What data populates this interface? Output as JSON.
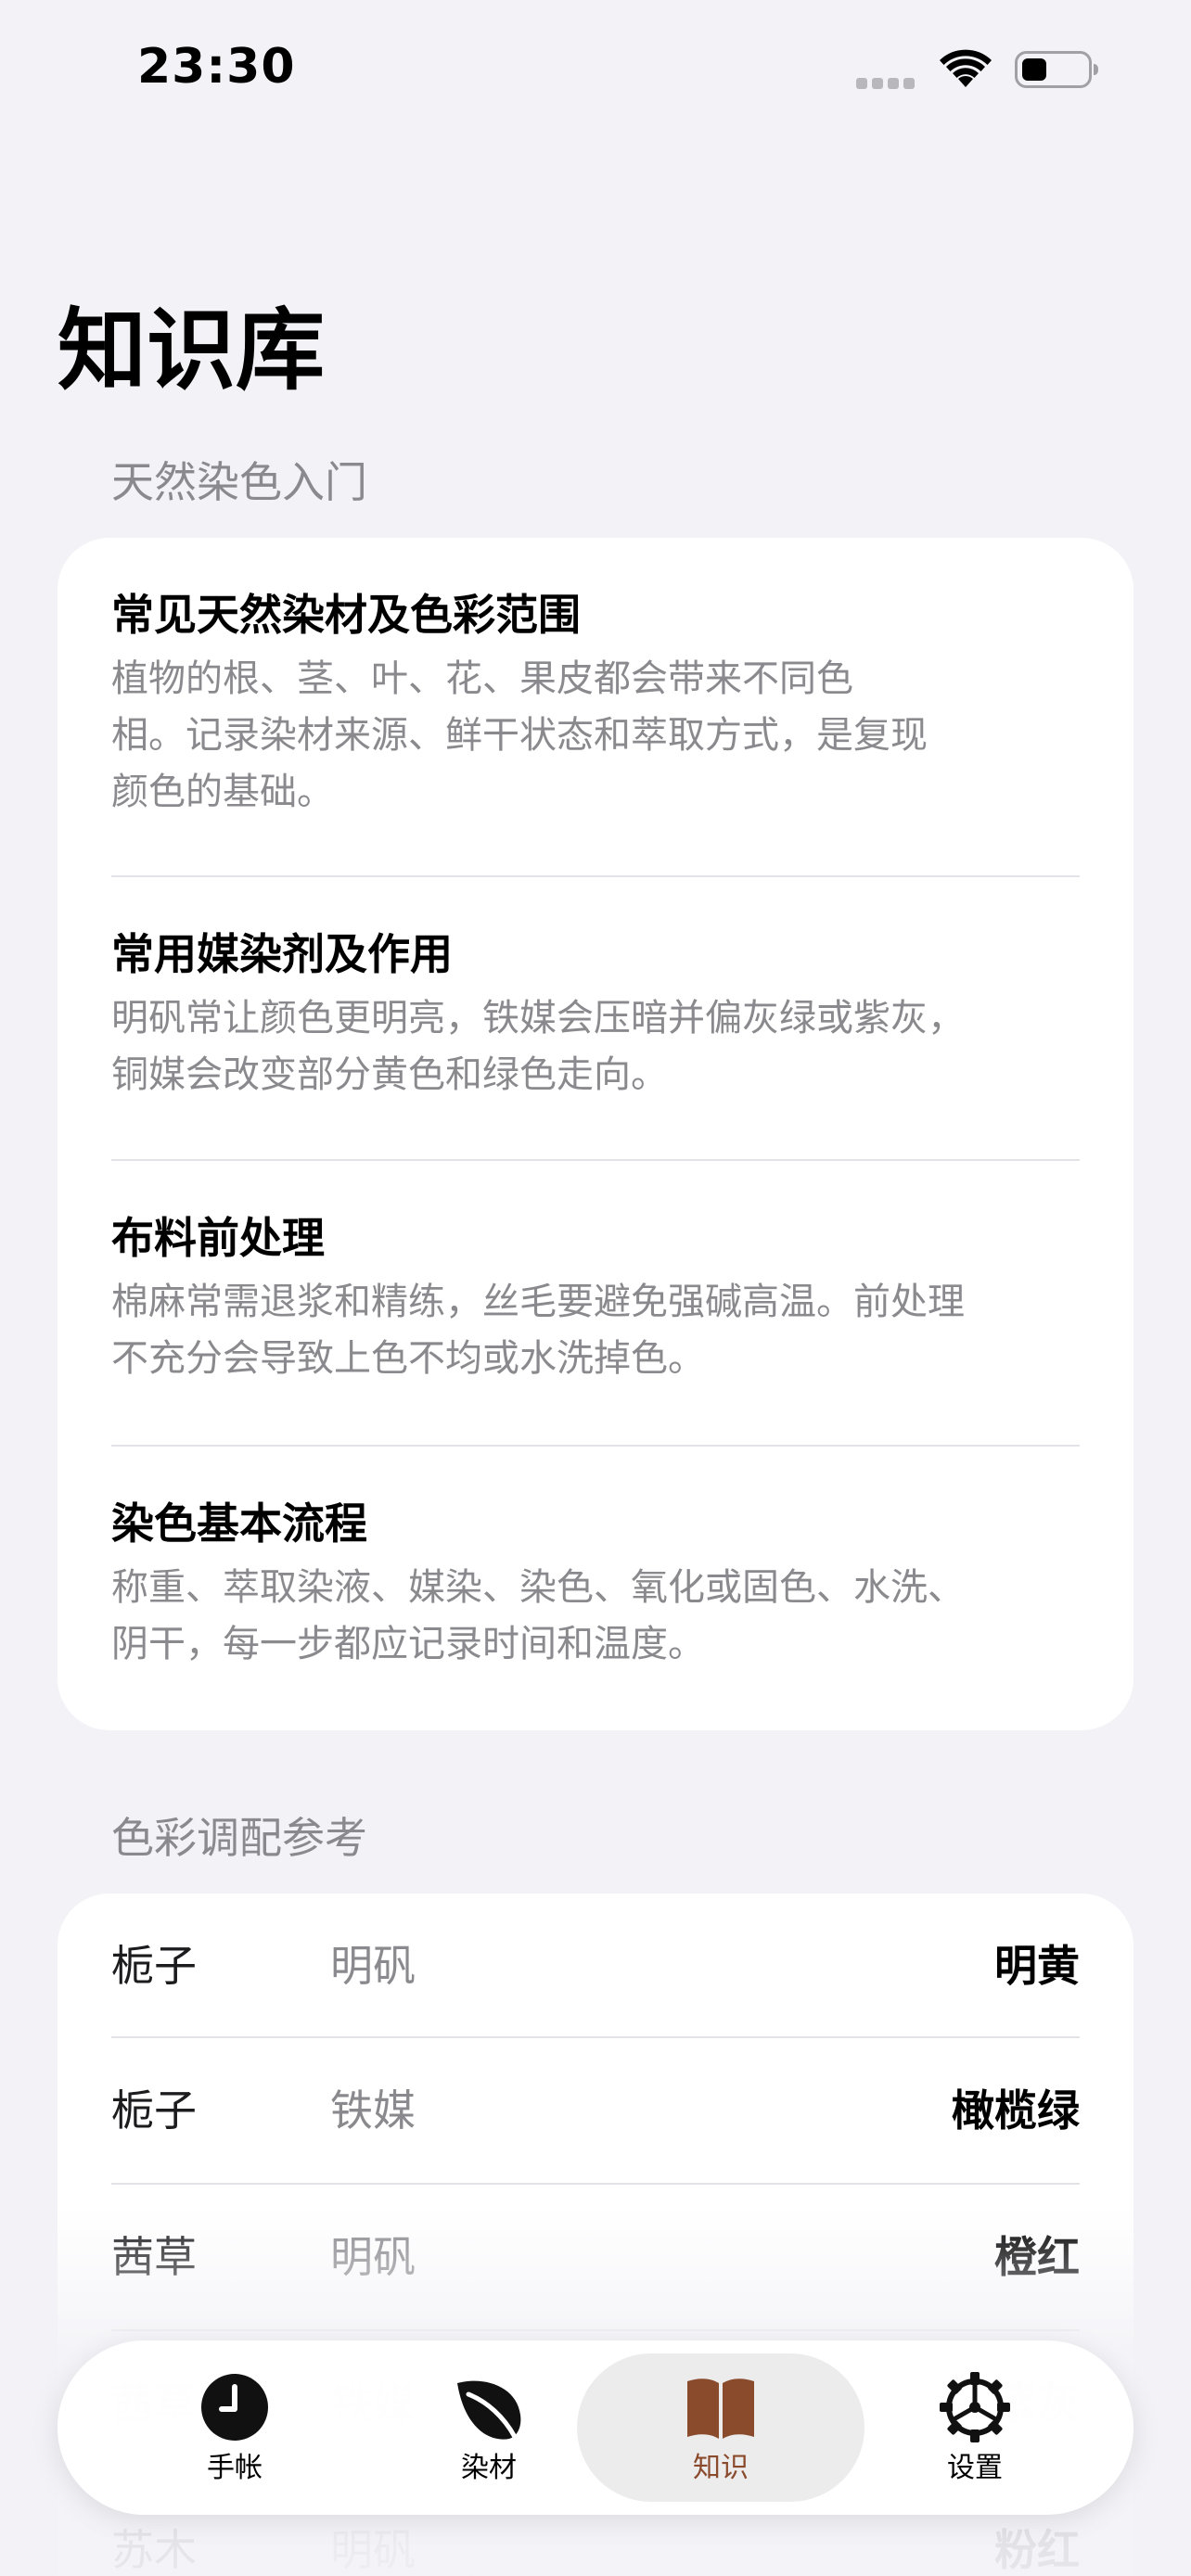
{
  "status_bar": {
    "time": "23:30"
  },
  "page": {
    "title": "知识库"
  },
  "sections": {
    "intro": {
      "header": "天然染色入门",
      "articles": [
        {
          "title": "常见天然染材及色彩范围",
          "body_lines": [
            "植物的根、茎、叶、花、果皮都会带来不同色",
            "相。记录染材来源、鲜干状态和萃取方式，是复现",
            "颜色的基础。"
          ]
        },
        {
          "title": "常用媒染剂及作用",
          "body_lines": [
            "明矾常让颜色更明亮，铁媒会压暗并偏灰绿或紫灰，",
            "铜媒会改变部分黄色和绿色走向。"
          ]
        },
        {
          "title": "布料前处理",
          "body_lines": [
            "棉麻常需退浆和精练，丝毛要避免强碱高温。前处理",
            "不充分会导致上色不均或水洗掉色。"
          ]
        },
        {
          "title": "染色基本流程",
          "body_lines": [
            "称重、萃取染液、媒染、染色、氧化或固色、水洗、",
            "阴干，每一步都应记录时间和温度。"
          ]
        }
      ]
    },
    "color_ref": {
      "header": "色彩调配参考",
      "rows": [
        {
          "dye": "栀子",
          "mordant": "明矾",
          "result": "明黄"
        },
        {
          "dye": "栀子",
          "mordant": "铁媒",
          "result": "橄榄绿"
        },
        {
          "dye": "茜草",
          "mordant": "明矾",
          "result": "橙红"
        },
        {
          "dye": "茜草",
          "mordant": "铁媒",
          "result": "紫灰"
        },
        {
          "dye": "苏木",
          "mordant": "明矾",
          "result": "粉红"
        }
      ]
    }
  },
  "tab_bar": {
    "tabs": [
      {
        "label": "手帐",
        "icon": "clock-icon"
      },
      {
        "label": "染材",
        "icon": "leaf-icon"
      },
      {
        "label": "知识",
        "icon": "book-icon"
      },
      {
        "label": "设置",
        "icon": "gear-icon"
      }
    ],
    "active_index": 2
  },
  "colors": {
    "background": "#f2f2f7",
    "card": "#ffffff",
    "secondary_text": "#8a8a8e",
    "accent": "#8a4a2c"
  }
}
